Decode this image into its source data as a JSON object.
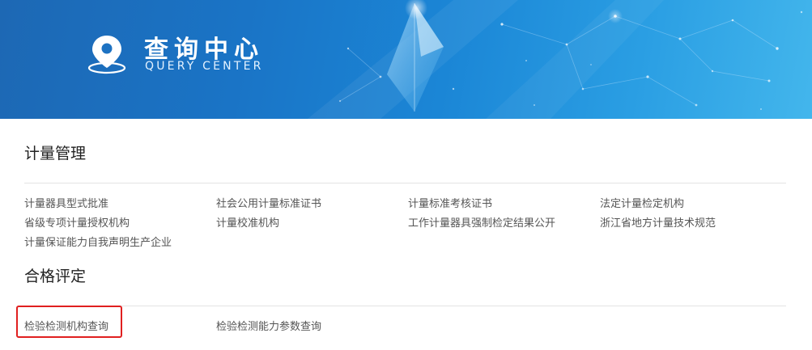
{
  "banner": {
    "title": "查询中心",
    "subtitle": "QUERY CENTER",
    "icon": "location-pin-icon"
  },
  "sections": [
    {
      "heading": "计量管理",
      "links": [
        "计量器具型式批准",
        "社会公用计量标准证书",
        "计量标准考核证书",
        "法定计量检定机构",
        "省级专项计量授权机构",
        "计量校准机构",
        "工作计量器具强制检定结果公开",
        "浙江省地方计量技术规范",
        "计量保证能力自我声明生产企业"
      ]
    },
    {
      "heading": "合格评定",
      "links": [
        "检验检测机构查询",
        "检验检测能力参数查询"
      ]
    }
  ],
  "colors": {
    "banner_start": "#1d68b4",
    "banner_end": "#43b6ec",
    "heading_text": "#222222",
    "link_text": "#555555",
    "highlight": "#e02020"
  }
}
